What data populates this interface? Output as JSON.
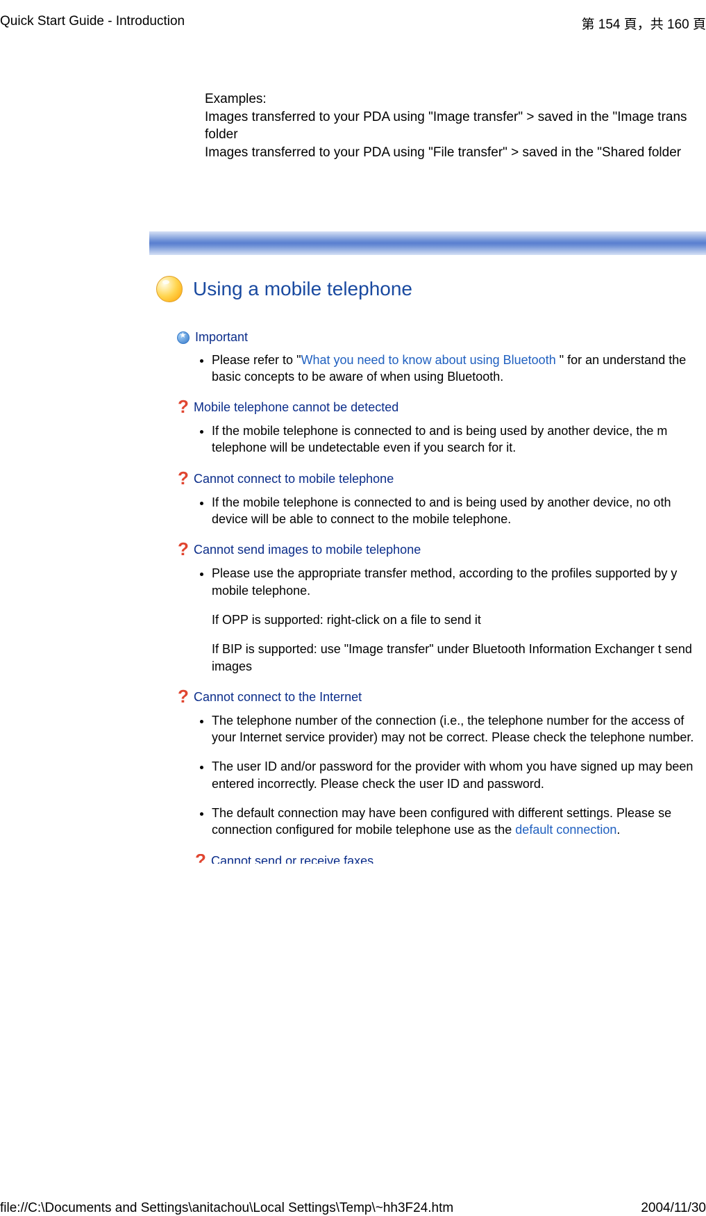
{
  "header": {
    "title": "Quick Start Guide - Introduction",
    "page_info": "第 154 頁，共 160 頁"
  },
  "examples": {
    "label": "Examples:",
    "line1": "Images transferred to your PDA using \"Image transfer\" > saved in the \"Image trans",
    "line2": "folder",
    "line3": "Images transferred to your PDA using \"File transfer\" > saved in the \"Shared folder"
  },
  "heading": "Using a mobile telephone",
  "sections": {
    "important": {
      "title": "Important",
      "bullet_prefix": "Please refer to \"",
      "bullet_link": "What you need to know about using Bluetooth",
      "bullet_suffix": " \" for an understand",
      "bullet_line2": "the basic concepts to be aware of when using Bluetooth."
    },
    "cannot_detect": {
      "title": "Mobile telephone cannot be detected",
      "bullet": "If the mobile telephone is connected to and is being used by another device, the m telephone will be undetectable even if you search for it."
    },
    "cannot_connect": {
      "title": "Cannot connect to mobile telephone",
      "bullet": "If the mobile telephone is connected to and is being used by another device, no oth device will be able to connect to the mobile telephone."
    },
    "cannot_send_images": {
      "title": "Cannot send images to mobile telephone",
      "bullet": "Please use the appropriate transfer method, according to the profiles supported by y mobile telephone.",
      "p1": "If OPP is supported: right-click on a file to send it",
      "p2": "If BIP is supported: use \"Image transfer\" under Bluetooth Information Exchanger t send images"
    },
    "cannot_internet": {
      "title": "Cannot connect to the Internet",
      "bullet1": "The telephone number of the connection (i.e., the telephone number for the access of your Internet service provider) may not be correct. Please check the telephone number.",
      "bullet2": "The user ID and/or password for the provider with whom you have signed up may been entered incorrectly. Please check the user ID and password.",
      "bullet3_prefix": "The default connection may have been configured with different settings. Please se connection configured for mobile telephone use as the  ",
      "bullet3_link": "default connection",
      "bullet3_suffix": "."
    },
    "cannot_fax": {
      "title": "Cannot send or receive faxes"
    }
  },
  "footer": {
    "path": "file://C:\\Documents and Settings\\anitachou\\Local Settings\\Temp\\~hh3F24.htm",
    "date": "2004/11/30"
  }
}
